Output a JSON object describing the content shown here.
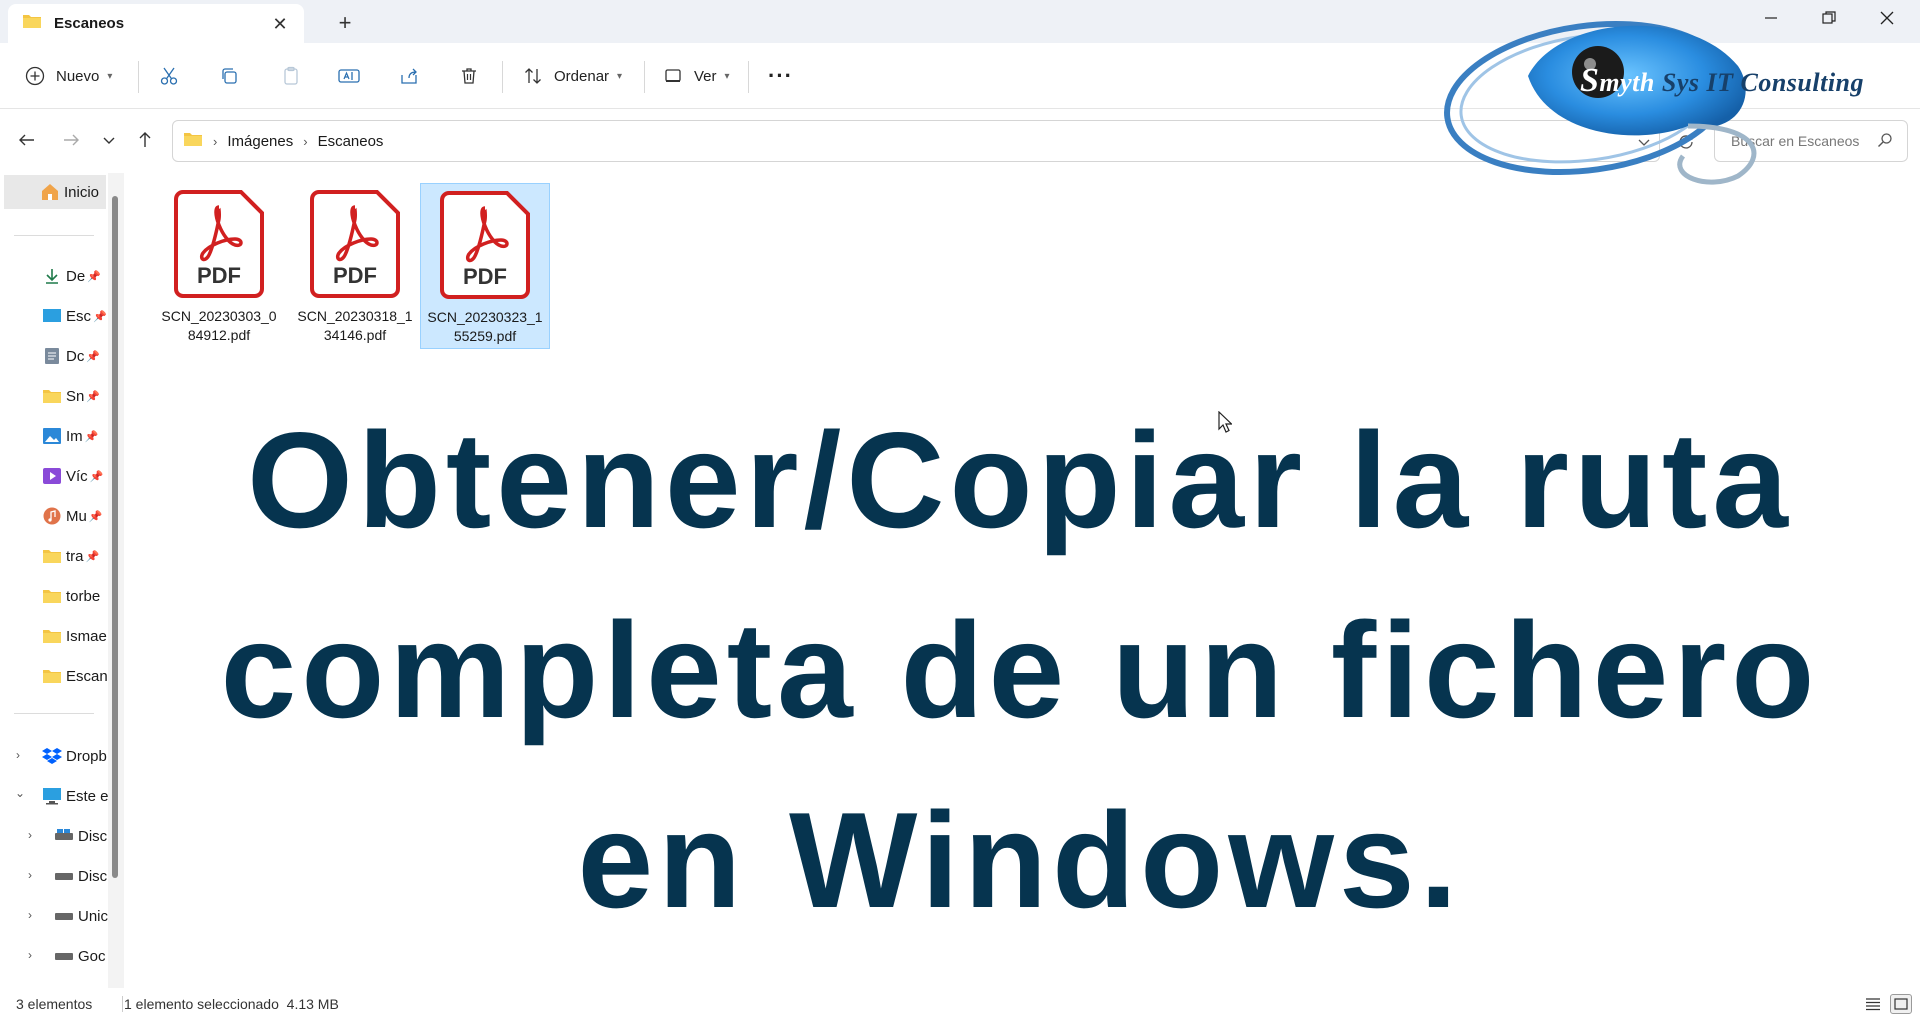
{
  "window": {
    "tab_title": "Escaneos",
    "new_tab_symbol": "+",
    "close_tab_symbol": "✕"
  },
  "toolbar": {
    "new_label": "Nuevo",
    "sort_label": "Ordenar",
    "view_label": "Ver",
    "more_label": "···"
  },
  "address": {
    "crumbs": [
      "Imágenes",
      "Escaneos"
    ],
    "search_placeholder": "Buscar en Escaneos"
  },
  "sidebar": {
    "home": "Inicio",
    "pinned": [
      "De",
      "Esc",
      "Dc",
      "Sn",
      "Im",
      "Víc",
      "Mu",
      "tra"
    ],
    "folders": [
      "torbe",
      "Ismae",
      "Escan"
    ],
    "dropbox": "Dropb",
    "this_pc": "Este e",
    "drives": [
      "Disc",
      "Disc",
      "Unic",
      "Goc"
    ]
  },
  "files": [
    {
      "name": "SCN_20230303_084912.pdf",
      "icon_label": "PDF"
    },
    {
      "name": "SCN_20230318_134146.pdf",
      "icon_label": "PDF"
    },
    {
      "name": "SCN_20230323_155259.pdf",
      "icon_label": "PDF"
    }
  ],
  "overlay": {
    "line1": "Obtener/Copiar la ruta",
    "line2": "completa de un fichero",
    "line3": "en Windows."
  },
  "logo": {
    "mark": "S",
    "text_white": "myth ",
    "text_dark": "Sys IT Consulting"
  },
  "status": {
    "count": "3 elementos",
    "selection": "1 elemento seleccionado  4.13 MB"
  },
  "colors": {
    "headline": "#06344f",
    "selection": "#cce8ff",
    "pdf_red": "#d12020",
    "folder_yellow": "#f4c543",
    "logo_blue": "#2b8fd6"
  }
}
